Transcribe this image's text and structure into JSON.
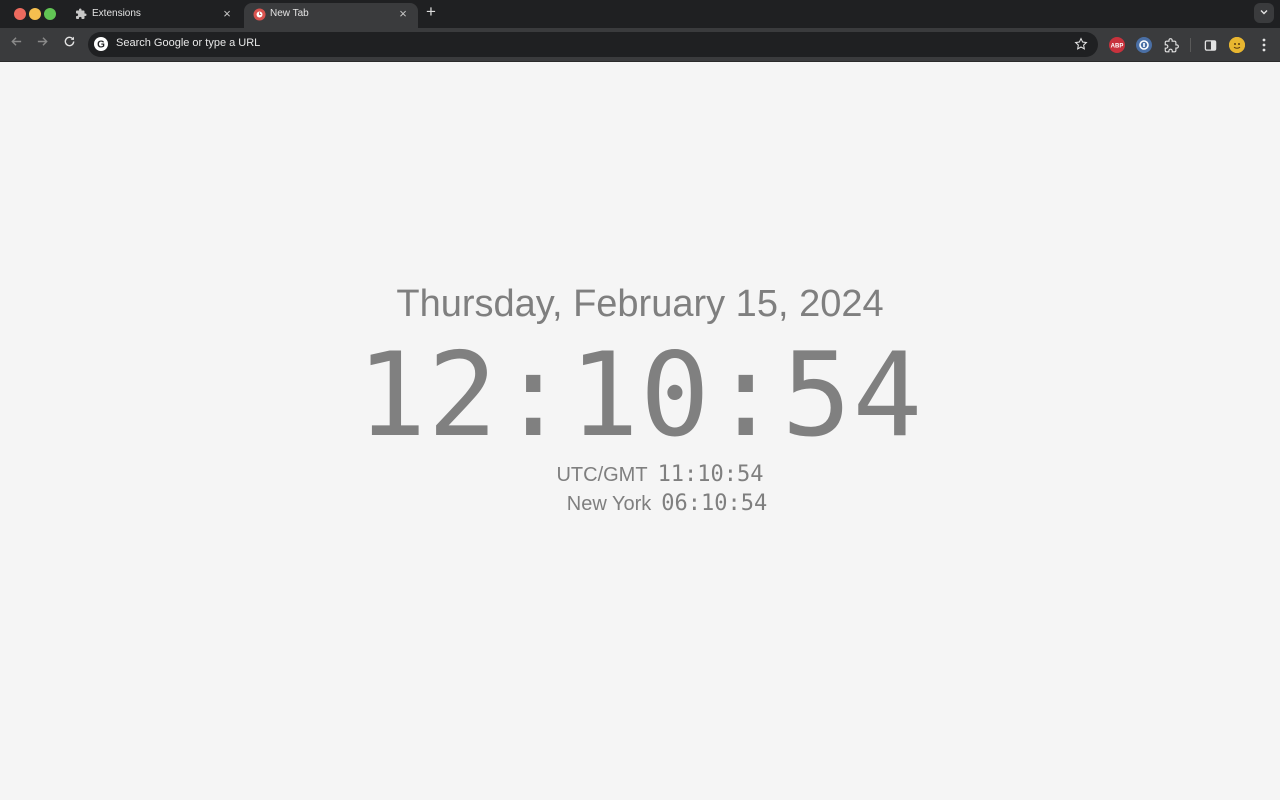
{
  "tabs": [
    {
      "title": "Extensions",
      "icon": "puzzle-icon",
      "active": false
    },
    {
      "title": "New Tab",
      "icon": "clock-extension-icon",
      "active": true
    }
  ],
  "omnibox": {
    "placeholder": "Search Google or type a URL"
  },
  "page": {
    "date": "Thursday, February 15, 2024",
    "time": "12:10:54",
    "zones": [
      {
        "label": "UTC/GMT",
        "time": "11:10:54"
      },
      {
        "label": "New York",
        "time": "06:10:54"
      }
    ]
  },
  "extensions": [
    {
      "name": "adblock-plus-icon",
      "badge": "ABP",
      "color": "#c8323d"
    },
    {
      "name": "vpn-extension-icon",
      "color": "#4a6fa5"
    },
    {
      "name": "extensions-puzzle-icon"
    }
  ],
  "colors": {
    "page_bg": "#f5f5f5",
    "text_gray": "#7f7f7f",
    "chrome_dark": "#1f2022",
    "toolbar": "#3a3b3d"
  }
}
